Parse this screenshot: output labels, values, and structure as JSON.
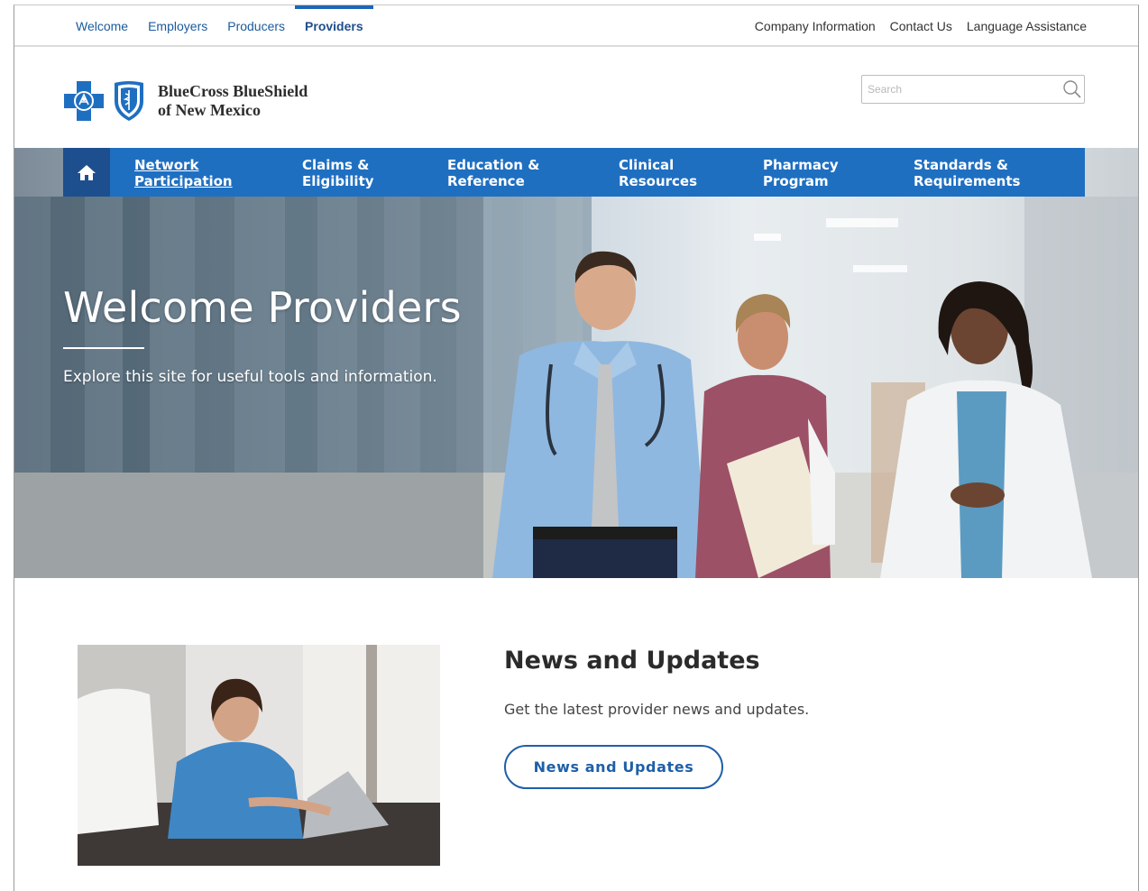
{
  "audience_tabs": [
    {
      "label": "Welcome"
    },
    {
      "label": "Employers"
    },
    {
      "label": "Producers"
    },
    {
      "label": "Providers",
      "active": true
    }
  ],
  "utility_links": [
    {
      "label": "Company Information"
    },
    {
      "label": "Contact Us"
    },
    {
      "label": "Language Assistance"
    }
  ],
  "brand": {
    "name_line1": "BlueCross BlueShield",
    "name_line2": "of New Mexico",
    "cross_icon": "blue-cross-icon",
    "shield_icon": "blue-shield-icon",
    "primary_color": "#1f6fc1",
    "dark_color": "#1d4f8f"
  },
  "search": {
    "placeholder": "Search",
    "icon": "search-icon"
  },
  "main_nav": {
    "home_icon": "home-icon",
    "items": [
      {
        "line1": "Network",
        "line2": "Participation",
        "active": true
      },
      {
        "line1": "Claims &",
        "line2": "Eligibility"
      },
      {
        "line1": "Education &",
        "line2": "Reference"
      },
      {
        "line1": "Clinical",
        "line2": "Resources"
      },
      {
        "line1": "Pharmacy",
        "line2": "Program"
      },
      {
        "line1": "Standards &",
        "line2": "Requirements"
      }
    ]
  },
  "hero": {
    "title": "Welcome Providers",
    "subtitle": "Explore this site for useful tools and information."
  },
  "news": {
    "title": "News and Updates",
    "description": "Get the latest provider news and updates.",
    "button_label": "News and Updates",
    "accent_color": "#1f5fa8"
  }
}
